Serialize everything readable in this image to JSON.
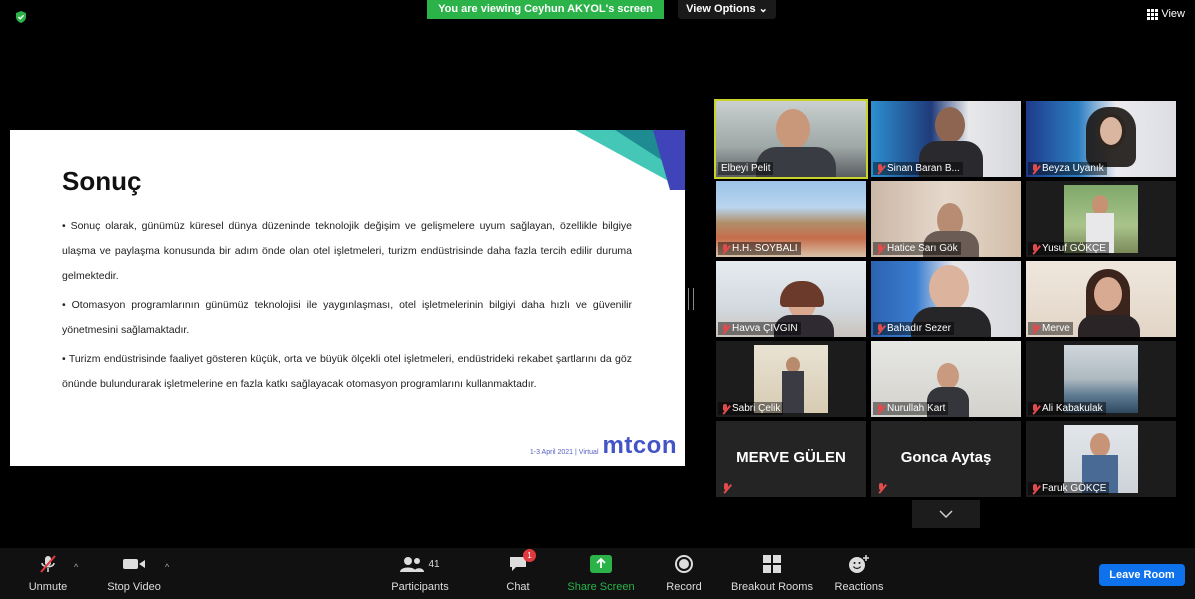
{
  "top": {
    "banner": "You are viewing Ceyhun AKYOL's screen",
    "view_options": "View Options",
    "view": "View"
  },
  "slide": {
    "title": "Sonuç",
    "bullets": [
      "•   Sonuç olarak, günümüz küresel dünya düzeninde teknolojik değişim ve gelişmelere uyum sağlayan, özellikle bilgiye ulaşma ve paylaşma konusunda bir adım önde olan otel işletmeleri, turizm endüstrisinde daha fazla tercih edilir duruma gelmektedir.",
      "•   Otomasyon programlarının günümüz teknolojisi ile yaygınlaşması, otel işletmelerinin bilgiyi daha hızlı ve güvenilir yönetmesini sağlamaktadır.",
      "•   Turizm endüstrisinde faaliyet gösteren küçük, orta ve büyük ölçekli otel işletmeleri, endüstrideki rekabet şartlarını da göz önünde bulundurarak işletmelerine en fazla katkı sağlayacak otomasyon programlarını kullanmaktadır."
    ],
    "footer_date": "1-3 April 2021 | Virtual",
    "footer_logo": "mtcon"
  },
  "participants": [
    {
      "name": "Elbeyi Pelit",
      "muted": false
    },
    {
      "name": "Sinan Baran B...",
      "muted": true
    },
    {
      "name": "Beyza Uyanık",
      "muted": true
    },
    {
      "name": "H.H. SOYBALI",
      "muted": true
    },
    {
      "name": "Hatice Sarı Gök",
      "muted": true
    },
    {
      "name": "Yusuf GÖKÇE",
      "muted": true
    },
    {
      "name": "Havva ÇIVGIN",
      "muted": true
    },
    {
      "name": "Bahadır Sezer",
      "muted": true
    },
    {
      "name": "Merve",
      "muted": true
    },
    {
      "name": "Sabri Çelik",
      "muted": true
    },
    {
      "name": "Nurullah Kart",
      "muted": true
    },
    {
      "name": "Ali Kabakulak",
      "muted": true
    },
    {
      "name": "MERVE GÜLEN",
      "muted": true
    },
    {
      "name": "Gonca Aytaş",
      "muted": true
    },
    {
      "name": "Faruk GÖKÇE",
      "muted": true
    }
  ],
  "toolbar": {
    "unmute": "Unmute",
    "stop_video": "Stop Video",
    "participants": "Participants",
    "participants_count": "41",
    "chat": "Chat",
    "chat_badge": "1",
    "share_screen": "Share Screen",
    "record": "Record",
    "breakout_rooms": "Breakout Rooms",
    "reactions": "Reactions",
    "leave": "Leave Room"
  },
  "colors": {
    "banner_green": "#2bb34a",
    "active_speaker": "#c9d42a",
    "leave_blue": "#0e72ed",
    "muted_red": "#e04b4b",
    "brand": "#4254c6"
  }
}
